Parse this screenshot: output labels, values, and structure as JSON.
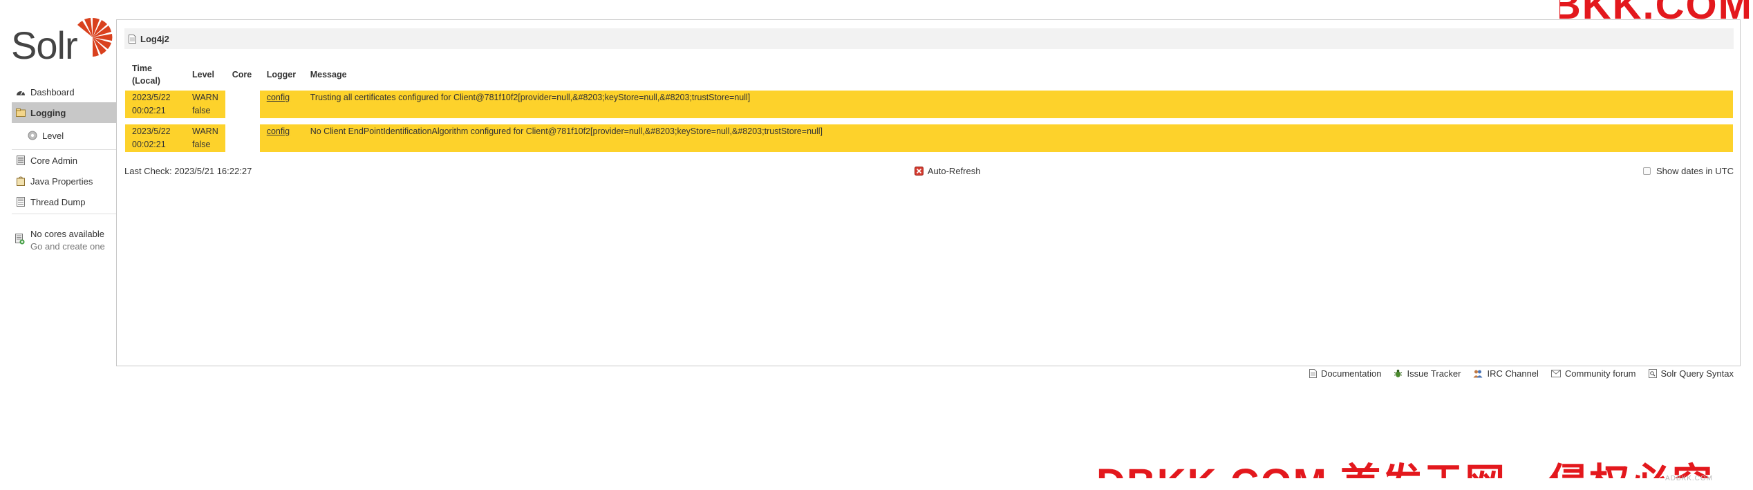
{
  "logo": {
    "text": "Solr",
    "brand_color": "#d9411e"
  },
  "watermark": {
    "top": "DBKK.COM",
    "bottom": "DBKK.COM 首发于网，侵权必究，转载请注明出处",
    "small": "ADBKK.COM"
  },
  "sidebar": {
    "items": [
      {
        "label": "Dashboard",
        "icon": "dashboard-icon",
        "active": false
      },
      {
        "label": "Logging",
        "icon": "logging-icon",
        "active": true
      },
      {
        "label": "Level",
        "icon": "level-icon",
        "active": false,
        "sub": true
      },
      {
        "label": "Core Admin",
        "icon": "core-admin-icon",
        "active": false
      },
      {
        "label": "Java Properties",
        "icon": "java-properties-icon",
        "active": false
      },
      {
        "label": "Thread Dump",
        "icon": "thread-dump-icon",
        "active": false
      }
    ],
    "no_cores": {
      "title": "No cores available",
      "subtitle": "Go and create one"
    }
  },
  "content": {
    "header": "Log4j2",
    "columns": {
      "time": "Time\n(Local)",
      "level": "Level",
      "core": "Core",
      "logger": "Logger",
      "message": "Message"
    },
    "rows": [
      {
        "date": "2023/5/22",
        "time": "00:02:21",
        "level": "WARN",
        "flag": "false",
        "core": "",
        "logger": "config",
        "message": "Trusting all certificates configured for Client@781f10f2[provider=null,&#8203;keyStore=null,&#8203;trustStore=null]"
      },
      {
        "date": "2023/5/22",
        "time": "00:02:21",
        "level": "WARN",
        "flag": "false",
        "core": "",
        "logger": "config",
        "message": "No Client EndPointIdentificationAlgorithm configured for Client@781f10f2[provider=null,&#8203;keyStore=null,&#8203;trustStore=null]"
      }
    ],
    "last_check": "Last Check: 2023/5/21 16:22:27",
    "auto_refresh": "Auto-Refresh",
    "show_dates_utc": "Show dates in UTC",
    "highlight_color": "#fdd22b"
  },
  "footer_links": [
    {
      "label": "Documentation",
      "icon": "documentation-icon"
    },
    {
      "label": "Issue Tracker",
      "icon": "bug-icon"
    },
    {
      "label": "IRC Channel",
      "icon": "irc-icon"
    },
    {
      "label": "Community forum",
      "icon": "mail-icon"
    },
    {
      "label": "Solr Query Syntax",
      "icon": "query-syntax-icon"
    }
  ]
}
